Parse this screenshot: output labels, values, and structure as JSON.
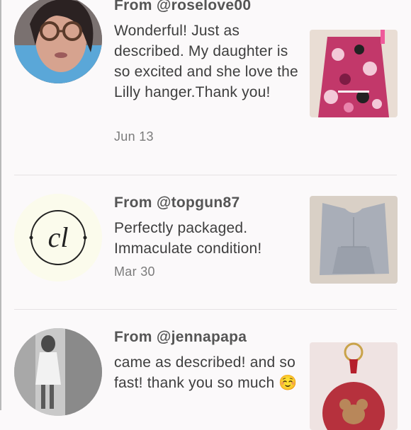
{
  "reviews": [
    {
      "from": "From @roselove00",
      "text": "Wonderful! Just as described. My daughter is so excited and she love the Lilly hanger.Thank you!",
      "date": "Jun 13",
      "avatar_icon": "user-photo-icon",
      "thumb_icon": "pink-floral-dress-icon"
    },
    {
      "from": "From @topgun87",
      "text": "Perfectly packaged. Immaculate condition!",
      "date": "Mar 30",
      "avatar_icon": "cl-monogram-logo-icon",
      "avatar_logo_text": "cl",
      "thumb_icon": "grey-top-icon"
    },
    {
      "from": "From @jennapapa",
      "text": "came as described! and so fast! thank you so much ☺️",
      "date": "",
      "avatar_icon": "user-photo-icon",
      "thumb_icon": "mirror-keychain-icon"
    }
  ],
  "colors": {
    "background": "#fbf9fa",
    "divider": "#e6e2e4",
    "text": "#3e3e3e",
    "muted": "#7b7b7b"
  }
}
